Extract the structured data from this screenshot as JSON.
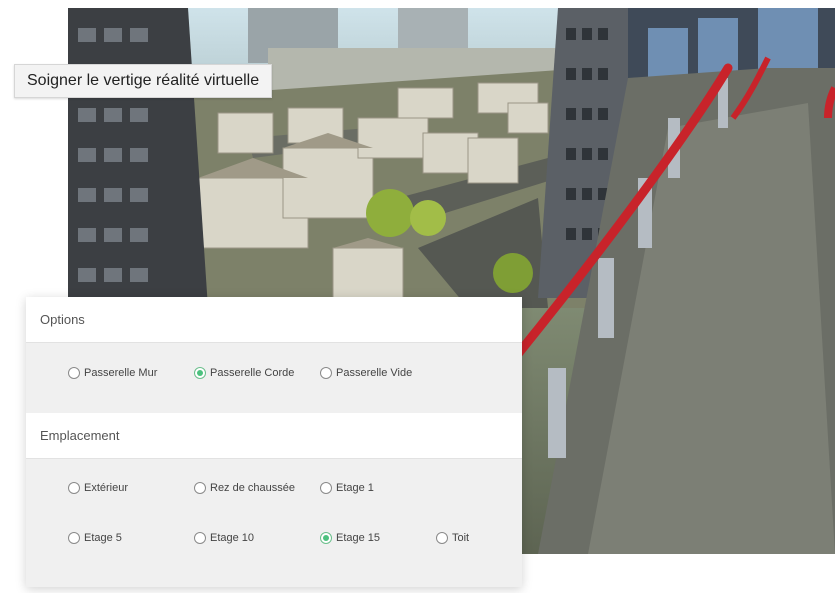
{
  "title": "Soigner le vertige réalité virtuelle",
  "options": {
    "label": "Options",
    "choices": [
      "Passerelle Mur",
      "Passerelle Corde",
      "Passerelle Vide"
    ],
    "selected": "Passerelle Corde"
  },
  "emplacement": {
    "label": "Emplacement",
    "choices": [
      "Extérieur",
      "Rez de chaussée",
      "Etage 1",
      "Etage 5",
      "Etage 10",
      "Etage 15",
      "Toit"
    ],
    "selected": "Etage 15"
  },
  "colors": {
    "radio_selected": "#4cc17e",
    "rope": "#c8232a"
  }
}
